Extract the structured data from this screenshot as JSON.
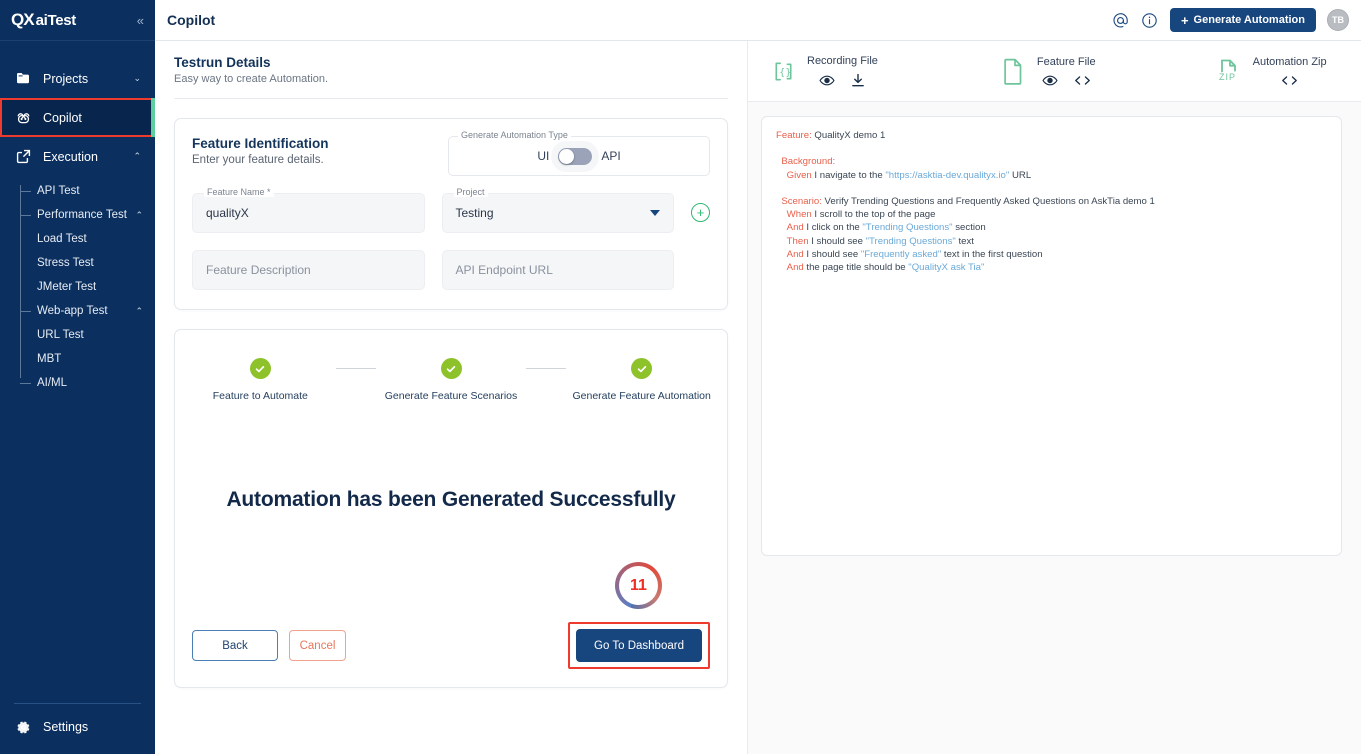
{
  "sidebar": {
    "logo_mark": "QX",
    "logo_text": "aiTest",
    "collapse_icon": "«",
    "items": [
      {
        "label": "Projects",
        "icon": "folder-icon",
        "chevron": "⌄"
      },
      {
        "label": "Copilot",
        "icon": "copilot-icon",
        "chevron": ""
      },
      {
        "label": "Execution",
        "icon": "execution-icon",
        "chevron": "⌃"
      }
    ],
    "sub_items": [
      {
        "label": "API Test",
        "level": 1,
        "chevron": ""
      },
      {
        "label": "Performance Test",
        "level": 1,
        "chevron": "⌃"
      },
      {
        "label": "Load Test",
        "level": 2,
        "chevron": ""
      },
      {
        "label": "Stress Test",
        "level": 2,
        "chevron": ""
      },
      {
        "label": "JMeter Test",
        "level": 2,
        "chevron": ""
      },
      {
        "label": "Web-app Test",
        "level": 1,
        "chevron": "⌃"
      },
      {
        "label": "URL Test",
        "level": 2,
        "chevron": ""
      },
      {
        "label": "MBT",
        "level": 2,
        "chevron": ""
      },
      {
        "label": "AI/ML",
        "level": 1,
        "chevron": ""
      }
    ],
    "settings_label": "Settings",
    "active_item": "Copilot",
    "accent_color": "#5ecf9c",
    "bg_color": "#0b2f5e"
  },
  "topbar": {
    "title": "Copilot",
    "mention_icon": "@",
    "info_icon": "i",
    "generate_button": "Generate Automation",
    "generate_plus": "+",
    "avatar_initials": "TB"
  },
  "testrun": {
    "title": "Testrun Details",
    "subtitle": "Easy way to create Automation."
  },
  "feature_identification": {
    "title": "Feature Identification",
    "subtitle": "Enter your feature details.",
    "type_legend": "Generate Automation Type",
    "toggle_left_label": "UI",
    "toggle_right_label": "API",
    "toggle_state": "UI",
    "feature_name_legend": "Feature Name *",
    "feature_name_value": "qualityX",
    "project_legend": "Project",
    "project_value": "Testing",
    "add_project_icon": "+",
    "feature_description_placeholder": "Feature Description",
    "api_endpoint_placeholder": "API Endpoint URL"
  },
  "stepper": {
    "steps": [
      {
        "label": "Feature to Automate",
        "complete": true
      },
      {
        "label": "Generate Feature Scenarios",
        "complete": true
      },
      {
        "label": "Generate Feature Automation",
        "complete": true
      }
    ],
    "complete_color": "#8dc22b"
  },
  "result": {
    "success_message": "Automation has been Generated Successfully",
    "badge_number": "11",
    "back_label": "Back",
    "cancel_label": "Cancel",
    "dashboard_label": "Go To Dashboard"
  },
  "files": [
    {
      "title": "Recording File",
      "icon": "json-braces-icon",
      "actions": [
        {
          "icon": "eye-icon",
          "name": "view"
        },
        {
          "icon": "download-icon",
          "name": "download"
        }
      ]
    },
    {
      "title": "Feature File",
      "icon": "document-icon",
      "actions": [
        {
          "icon": "eye-icon",
          "name": "view"
        },
        {
          "icon": "code-icon",
          "name": "code"
        }
      ]
    },
    {
      "title": "Automation Zip",
      "icon": "zip-icon",
      "icon_label": "ZIP",
      "actions": [
        {
          "icon": "code-icon",
          "name": "code"
        }
      ]
    }
  ],
  "feature_file": {
    "lines": [
      {
        "indent": 0,
        "parts": [
          {
            "t": "kw",
            "s": "Feature:"
          },
          {
            "t": "txt",
            "s": " QualityX demo 1"
          }
        ]
      },
      {
        "indent": 0,
        "parts": [
          {
            "t": "sp",
            "s": ""
          }
        ]
      },
      {
        "indent": 1,
        "parts": [
          {
            "t": "kw",
            "s": "Background:"
          }
        ]
      },
      {
        "indent": 2,
        "parts": [
          {
            "t": "kw",
            "s": "Given"
          },
          {
            "t": "txt",
            "s": " I navigate to the "
          },
          {
            "t": "str",
            "s": "\"https://asktia-dev.qualityx.io\""
          },
          {
            "t": "txt",
            "s": " URL"
          }
        ]
      },
      {
        "indent": 0,
        "parts": [
          {
            "t": "sp",
            "s": ""
          }
        ]
      },
      {
        "indent": 1,
        "parts": [
          {
            "t": "kw",
            "s": "Scenario:"
          },
          {
            "t": "txt",
            "s": " Verify Trending Questions and Frequently Asked Questions on AskTia demo 1"
          }
        ]
      },
      {
        "indent": 2,
        "parts": [
          {
            "t": "kw",
            "s": "When"
          },
          {
            "t": "txt",
            "s": " I scroll to the top of the page"
          }
        ]
      },
      {
        "indent": 2,
        "parts": [
          {
            "t": "kw",
            "s": "And"
          },
          {
            "t": "txt",
            "s": " I click on the "
          },
          {
            "t": "str",
            "s": "\"Trending Questions\""
          },
          {
            "t": "txt",
            "s": " section"
          }
        ]
      },
      {
        "indent": 2,
        "parts": [
          {
            "t": "kw",
            "s": "Then"
          },
          {
            "t": "txt",
            "s": " I should see "
          },
          {
            "t": "str",
            "s": "\"Trending Questions\""
          },
          {
            "t": "txt",
            "s": " text"
          }
        ]
      },
      {
        "indent": 2,
        "parts": [
          {
            "t": "kw",
            "s": "And"
          },
          {
            "t": "txt",
            "s": " I should see "
          },
          {
            "t": "str",
            "s": "\"Frequently asked\""
          },
          {
            "t": "txt",
            "s": " text in the first question"
          }
        ]
      },
      {
        "indent": 2,
        "parts": [
          {
            "t": "kw",
            "s": "And"
          },
          {
            "t": "txt",
            "s": " the page title should be "
          },
          {
            "t": "str",
            "s": "\"QualityX ask Tia\""
          }
        ]
      }
    ]
  },
  "colors": {
    "brand_navy": "#17457e",
    "sidebar_navy": "#0b2f5e",
    "highlight_red": "#ef3b2d",
    "success_green": "#8dc22b",
    "accent_green": "#5ecf9c"
  }
}
